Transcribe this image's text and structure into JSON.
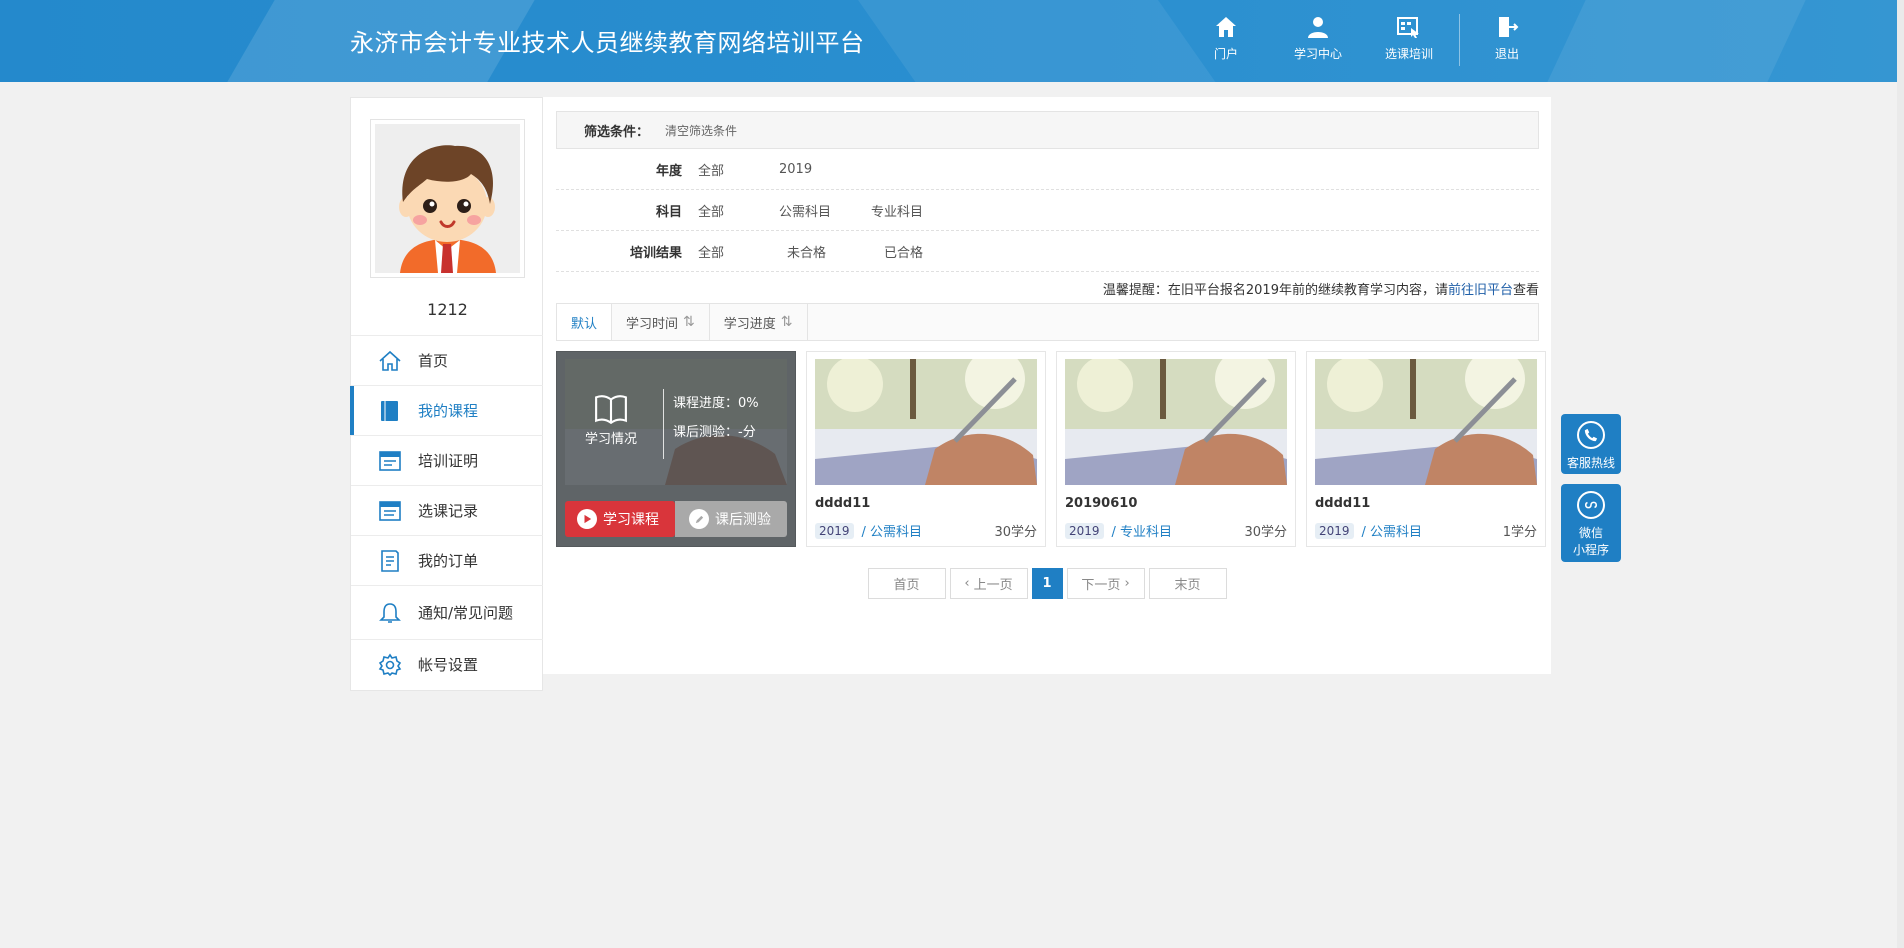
{
  "header": {
    "title": "永济市会计专业技术人员继续教育网络培训平台",
    "nav": [
      {
        "label": "门户",
        "icon": "home-icon"
      },
      {
        "label": "学习中心",
        "icon": "user-icon"
      },
      {
        "label": "选课培训",
        "icon": "course-select-icon"
      },
      {
        "label": "退出",
        "icon": "logout-icon"
      }
    ]
  },
  "sidebar": {
    "username": "1212",
    "items": [
      {
        "label": "首页",
        "icon": "home-outline-icon"
      },
      {
        "label": "我的课程",
        "icon": "book-icon"
      },
      {
        "label": "培训证明",
        "icon": "certificate-icon"
      },
      {
        "label": "选课记录",
        "icon": "record-icon"
      },
      {
        "label": "我的订单",
        "icon": "order-icon"
      },
      {
        "label": "通知/常见问题",
        "icon": "bell-icon"
      },
      {
        "label": "帐号设置",
        "icon": "gear-icon"
      }
    ]
  },
  "filter": {
    "label": "筛选条件：",
    "clear": "清空筛选条件",
    "year": {
      "key": "年度",
      "options": [
        "全部",
        "2019"
      ]
    },
    "subject": {
      "key": "科目",
      "options": [
        "全部",
        "公需科目",
        "专业科目"
      ]
    },
    "result": {
      "key": "培训结果",
      "options": [
        "全部",
        "未合格",
        "已合格"
      ]
    }
  },
  "tip": {
    "prefix": "温馨提醒：在旧平台报名2019年前的继续教育学习内容，请",
    "link": "前往旧平台",
    "suffix": "查看"
  },
  "tabs": [
    "默认",
    "学习时间",
    "学习进度"
  ],
  "courses": [
    {
      "name": "dddd11",
      "year": "2019",
      "subject": "/ 公需科目",
      "credit": "30学分",
      "overlay": {
        "status": "学习情况",
        "progress": "课程进度：0%",
        "test": "课后测验：-分",
        "study_btn": "学习课程",
        "test_btn": "课后测验"
      }
    },
    {
      "name": "dddd11",
      "year": "2019",
      "subject": "/ 公需科目",
      "credit": "30学分"
    },
    {
      "name": "20190610",
      "year": "2019",
      "subject": "/ 专业科目",
      "credit": "30学分"
    },
    {
      "name": "dddd11",
      "year": "2019",
      "subject": "/ 公需科目",
      "credit": "1学分"
    }
  ],
  "pager": {
    "first": "首页",
    "prev": "上一页",
    "current": "1",
    "next": "下一页",
    "last": "末页"
  },
  "float": {
    "hotline": "客服热线",
    "wechat_1": "微信",
    "wechat_2": "小程序"
  },
  "colors": {
    "primary": "#1f7fc4",
    "header": "#2489cc",
    "study_button": "#d9353b"
  }
}
